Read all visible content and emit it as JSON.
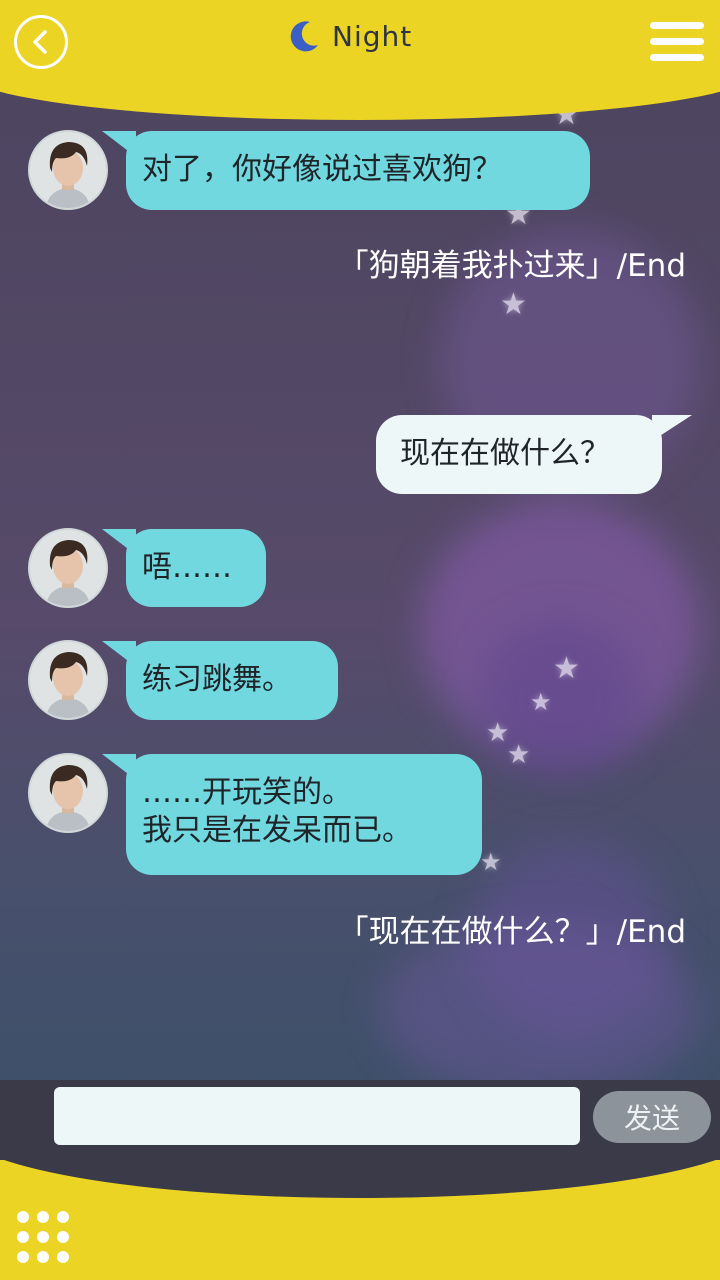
{
  "header": {
    "title": "Night",
    "back_icon": "chevron-left-icon",
    "moon_icon": "moon-icon",
    "menu_icon": "hamburger-menu-icon"
  },
  "messages": [
    {
      "side": "left",
      "text": "对了，你好像说过喜欢狗？"
    },
    {
      "side": "system",
      "text": "「狗朝着我扑过来」/End"
    },
    {
      "side": "right",
      "text": "现在在做什么？"
    },
    {
      "side": "left",
      "text": "唔……"
    },
    {
      "side": "left",
      "text": "练习跳舞。"
    },
    {
      "side": "left",
      "text": "……开玩笑的。\n我只是在发呆而已。"
    },
    {
      "side": "system",
      "text": "「现在在做什么？」/End"
    }
  ],
  "input": {
    "value": "",
    "placeholder": "",
    "send_label": "发送"
  },
  "footer": {
    "grid_icon": "grid-dots-icon"
  },
  "colors": {
    "header_yellow": "#ebd424",
    "bubble_cyan": "#71d8e0",
    "bubble_white": "#eef7f8",
    "input_bar": "#3a3a48",
    "send_button": "#8c939a"
  }
}
